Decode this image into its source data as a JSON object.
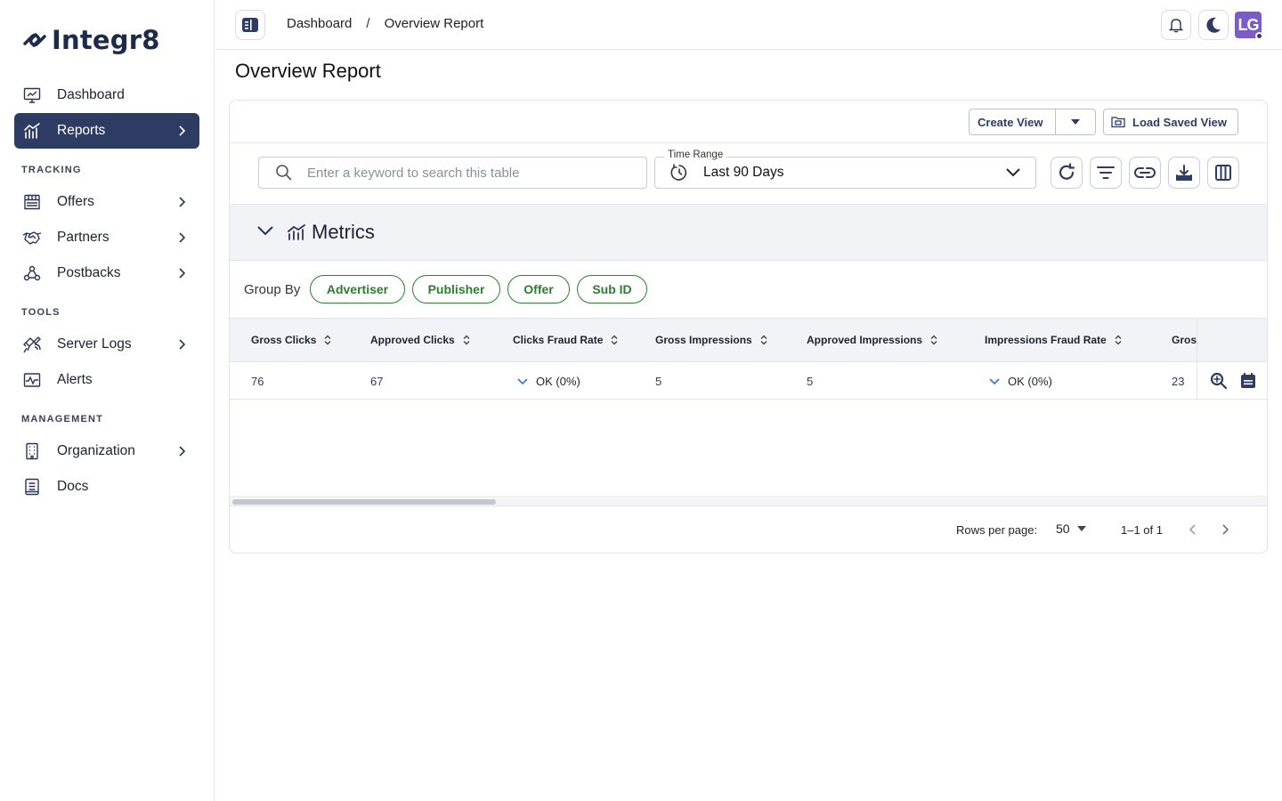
{
  "app": {
    "name": "Integr8"
  },
  "sidebar": {
    "items": [
      {
        "label": "Dashboard"
      },
      {
        "label": "Reports"
      }
    ],
    "sections": [
      {
        "label": "TRACKING",
        "items": [
          {
            "label": "Offers"
          },
          {
            "label": "Partners"
          },
          {
            "label": "Postbacks"
          }
        ]
      },
      {
        "label": "TOOLS",
        "items": [
          {
            "label": "Server Logs"
          },
          {
            "label": "Alerts"
          }
        ]
      },
      {
        "label": "MANAGEMENT",
        "items": [
          {
            "label": "Organization"
          },
          {
            "label": "Docs"
          }
        ]
      }
    ]
  },
  "header": {
    "breadcrumbs": [
      "Dashboard",
      "Overview Report"
    ],
    "separator": "/",
    "avatar_initials": "LG"
  },
  "page": {
    "title": "Overview Report"
  },
  "toolbar": {
    "create_view": "Create View",
    "load_saved_view": "Load Saved View",
    "search_placeholder": "Enter a keyword to search this table",
    "time_range_label": "Time Range",
    "time_range_value": "Last 90 Days"
  },
  "metrics": {
    "title": "Metrics"
  },
  "group_by": {
    "label": "Group By",
    "chips": [
      "Advertiser",
      "Publisher",
      "Offer",
      "Sub ID"
    ]
  },
  "table": {
    "columns": [
      "Gross Clicks",
      "Approved Clicks",
      "Clicks Fraud Rate",
      "Gross Impressions",
      "Approved Impressions",
      "Impressions Fraud Rate",
      "Gros"
    ],
    "rows": [
      {
        "cells": [
          "76",
          "67",
          "OK (0%)",
          "5",
          "5",
          "OK (0%)",
          "23"
        ]
      }
    ]
  },
  "pagination": {
    "rows_per_page_label": "Rows per page:",
    "rows_per_page": "50",
    "range": "1–1 of 1"
  },
  "colors": {
    "primary": "#2e3b63",
    "chip": "#2e7d32",
    "avatar": "#7b5ac9"
  }
}
